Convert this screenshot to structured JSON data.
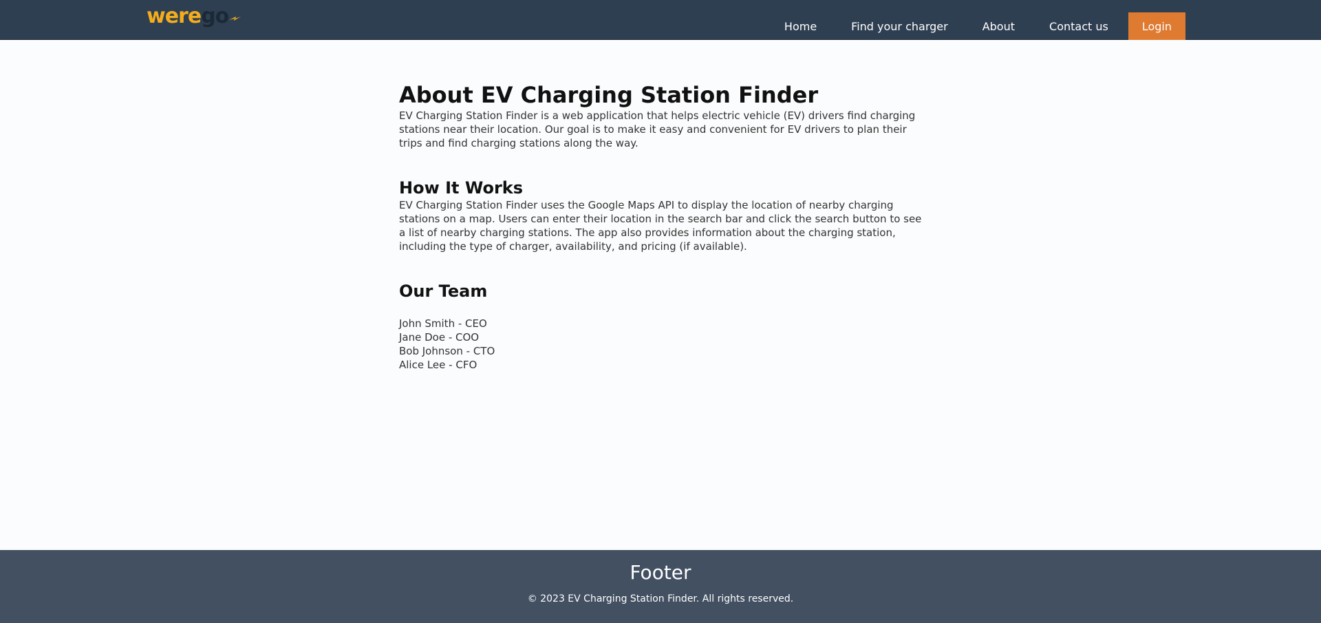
{
  "header": {
    "logo": {
      "part1": "were",
      "part2": "go",
      "icon": "plug-icon"
    },
    "nav": [
      {
        "label": "Home"
      },
      {
        "label": "Find your charger"
      },
      {
        "label": "About"
      },
      {
        "label": "Contact us"
      }
    ],
    "login_label": "Login"
  },
  "main": {
    "about": {
      "title": "About EV Charging Station Finder",
      "text": "EV Charging Station Finder is a web application that helps electric vehicle (EV) drivers find charging stations near their location. Our goal is to make it easy and convenient for EV drivers to plan their trips and find charging stations along the way."
    },
    "how": {
      "title": "How It Works",
      "text": "EV Charging Station Finder uses the Google Maps API to display the location of nearby charging stations on a map. Users can enter their location in the search bar and click the search button to see a list of nearby charging stations. The app also provides information about the charging station, including the type of charger, availability, and pricing (if available)."
    },
    "team": {
      "title": "Our Team",
      "members": [
        "John Smith - CEO",
        "Jane Doe - COO",
        "Bob Johnson - CTO",
        "Alice Lee - CFO"
      ]
    }
  },
  "footer": {
    "title": "Footer",
    "copyright": "© 2023 EV Charging Station Finder. All rights reserved."
  },
  "colors": {
    "navbar": "#2f3f52",
    "accent": "#df7a31",
    "logo_yellow": "#f3ad1d",
    "footer": "#425062",
    "background": "#fbfcfd"
  }
}
